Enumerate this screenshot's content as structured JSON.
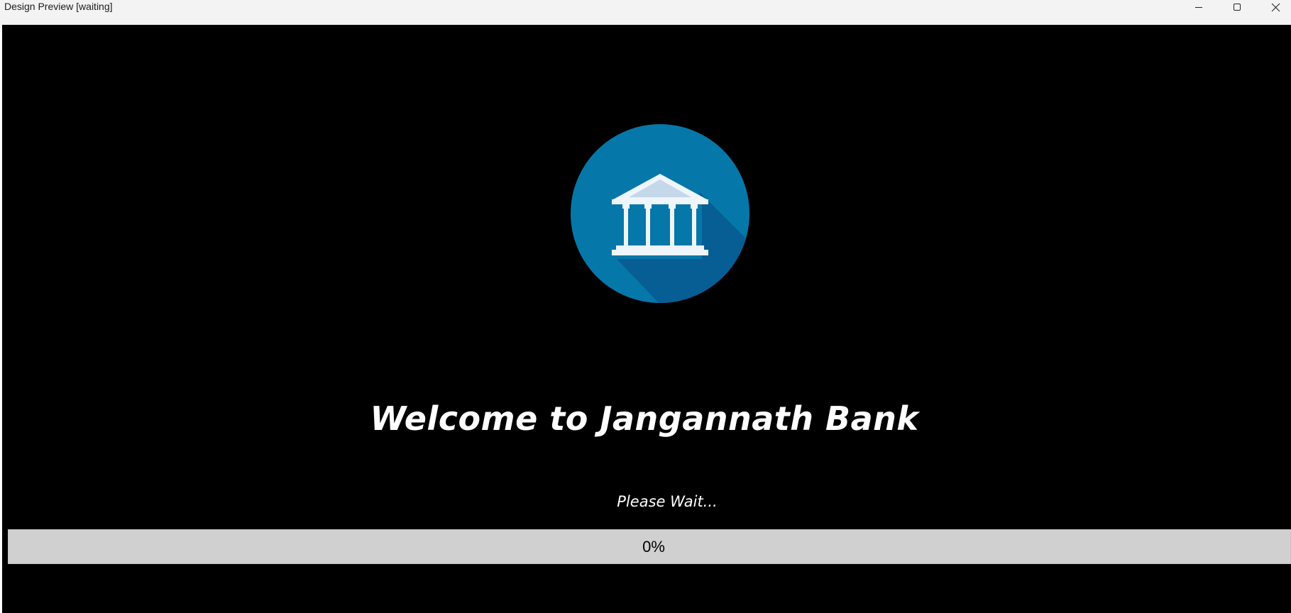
{
  "window": {
    "title": "Design Preview [waiting]",
    "controls": {
      "minimize_icon": "minimize-icon",
      "maximize_icon": "maximize-icon",
      "close_icon": "close-icon"
    }
  },
  "splash": {
    "logo_icon": "bank-building-icon",
    "welcome_text": "Welcome to Jangannath Bank",
    "status_text": "Please Wait...",
    "progress": {
      "value": 0,
      "label": "0%"
    }
  },
  "colors": {
    "background": "#000000",
    "logo_circle": "#0677a9",
    "logo_shadow": "#065e95",
    "progress_track": "#d0d0d0",
    "text": "#ffffff"
  }
}
